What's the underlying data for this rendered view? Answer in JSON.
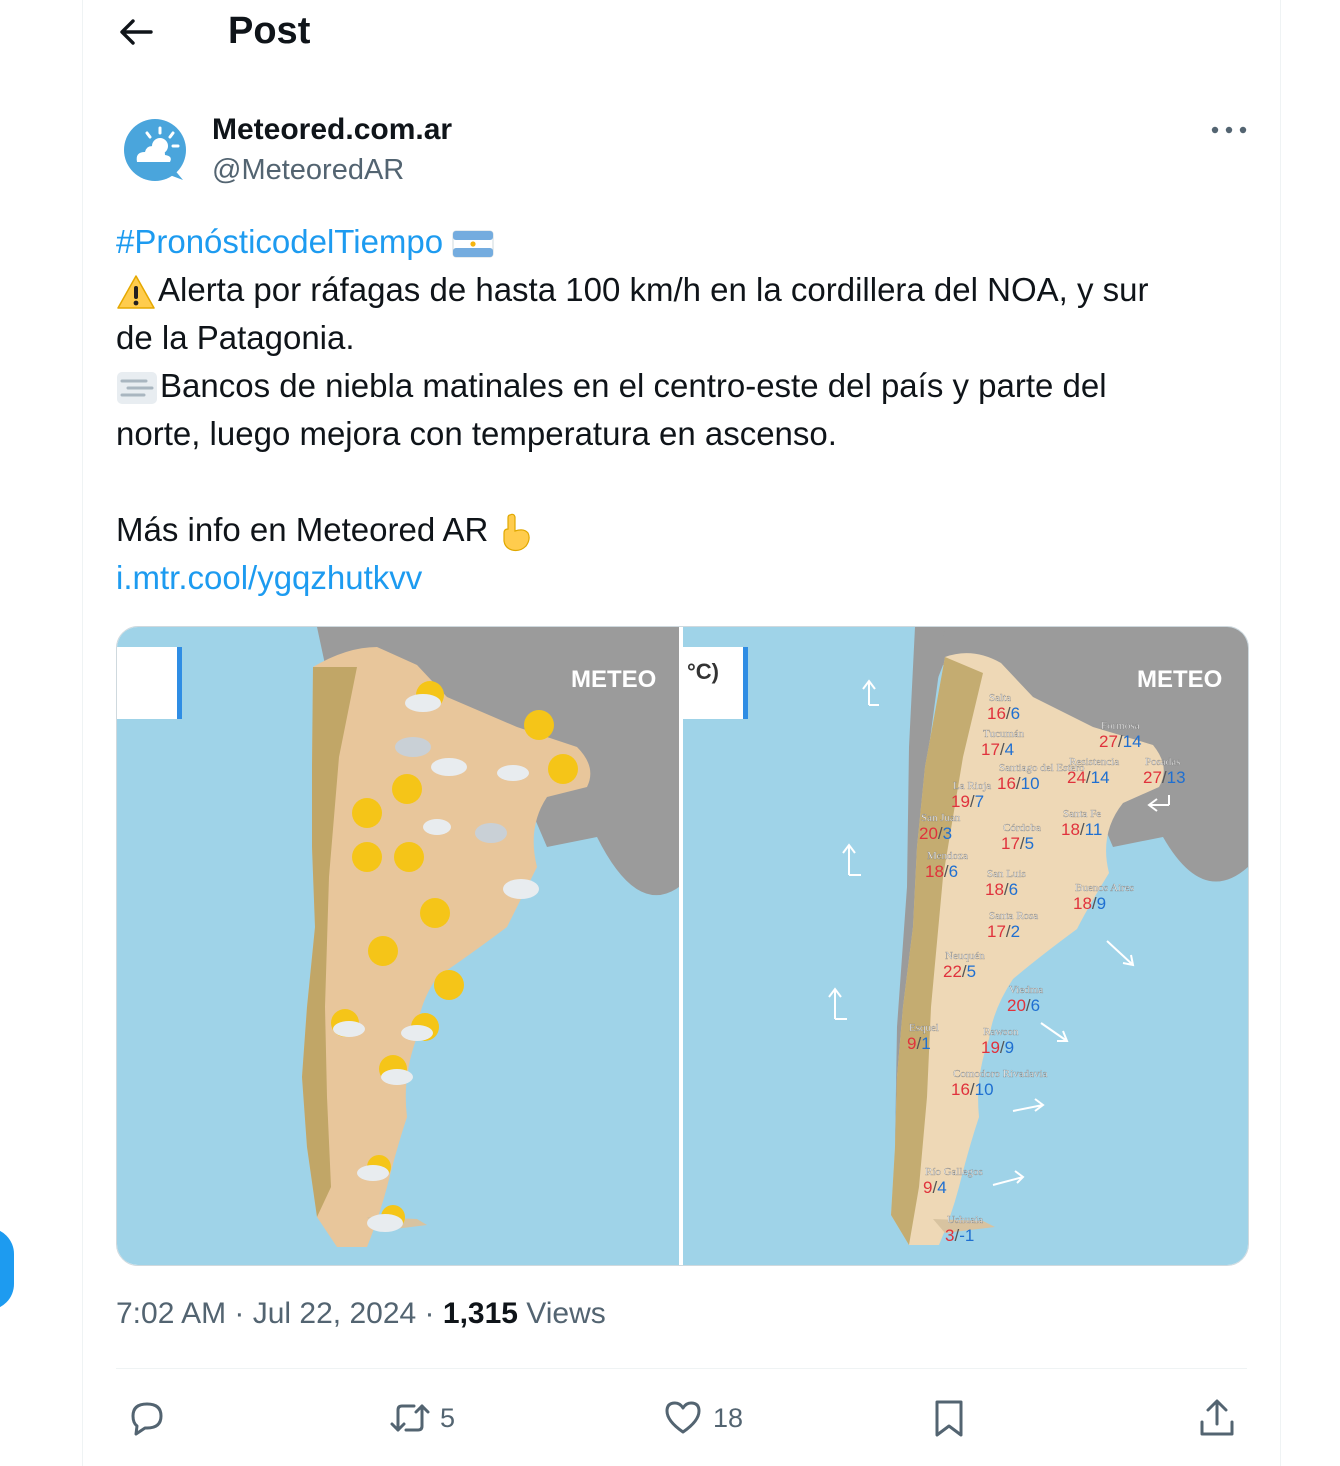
{
  "header": {
    "title": "Post",
    "back_icon": "arrow-left-icon"
  },
  "author": {
    "display_name": "Meteored.com.ar",
    "handle": "@MeteoredAR",
    "avatar_color": "#4aa5dc"
  },
  "tweet": {
    "hashtag": "#PronósticodelTiempo",
    "alert_line_1": "Alerta por ráfagas de hasta 100 km/h en la cordillera del NOA, y sur",
    "alert_line_2": "de la Patagonia.",
    "fog_line_1": "Bancos de niebla matinales en el centro-este del país y parte del",
    "fog_line_2": "norte, luego mejora con temperatura en ascenso.",
    "more_info": "Más info en Meteored AR",
    "link": "i.mtr.cool/ygqzhutkvv"
  },
  "media": {
    "left_map": {
      "brand": "METEO"
    },
    "right_map": {
      "brand": "METEO",
      "unit_fragment": "°C)",
      "cities": [
        {
          "name": "Salta",
          "max": "16",
          "min": "6"
        },
        {
          "name": "Tucumán",
          "max": "17",
          "min": "4"
        },
        {
          "name": "Santiago del Estero",
          "max": "16",
          "min": "10"
        },
        {
          "name": "La Rioja",
          "max": "19",
          "min": "7"
        },
        {
          "name": "San Juan",
          "max": "20",
          "min": "3"
        },
        {
          "name": "Córdoba",
          "max": "17",
          "min": "5"
        },
        {
          "name": "Mendoza",
          "max": "18",
          "min": "6"
        },
        {
          "name": "San Luis",
          "max": "18",
          "min": "6"
        },
        {
          "name": "Formosa",
          "max": "27",
          "min": "14"
        },
        {
          "name": "Resistencia",
          "max": "24",
          "min": "14"
        },
        {
          "name": "Posadas",
          "max": "27",
          "min": "13"
        },
        {
          "name": "Santa Fe",
          "max": "18",
          "min": "11"
        },
        {
          "name": "Buenos Aires",
          "max": "18",
          "min": "9"
        },
        {
          "name": "Santa Rosa",
          "max": "17",
          "min": "2"
        },
        {
          "name": "Neuquén",
          "max": "22",
          "min": "5"
        },
        {
          "name": "Viedma",
          "max": "20",
          "min": "6"
        },
        {
          "name": "Esquel",
          "max": "9",
          "min": "1"
        },
        {
          "name": "Rawson",
          "max": "19",
          "min": "9"
        },
        {
          "name": "Comodoro Rivadavia",
          "max": "16",
          "min": "10"
        },
        {
          "name": "Río Gallegos",
          "max": "9",
          "min": "4"
        },
        {
          "name": "Ushuaia",
          "max": "3",
          "min": "-1"
        }
      ]
    }
  },
  "meta": {
    "time": "7:02 AM",
    "sep1": " · ",
    "date": "Jul 22, 2024",
    "sep2": " · ",
    "views_count": "1,315",
    "views_label": " Views"
  },
  "actions": {
    "reply": {
      "icon": "reply-icon",
      "count": ""
    },
    "repost": {
      "icon": "repost-icon",
      "count": "5"
    },
    "like": {
      "icon": "heart-icon",
      "count": "18"
    },
    "bookmark": {
      "icon": "bookmark-icon",
      "count": ""
    },
    "share": {
      "icon": "share-icon",
      "count": ""
    }
  },
  "colors": {
    "link": "#1d9bf0",
    "secondary_text": "#536471",
    "ocean": "#9fd3e8",
    "land": "#f0d9b5",
    "neighbor_land": "#9a9a9a",
    "temp_max": "#e0323c",
    "temp_min": "#1f6fd1"
  }
}
